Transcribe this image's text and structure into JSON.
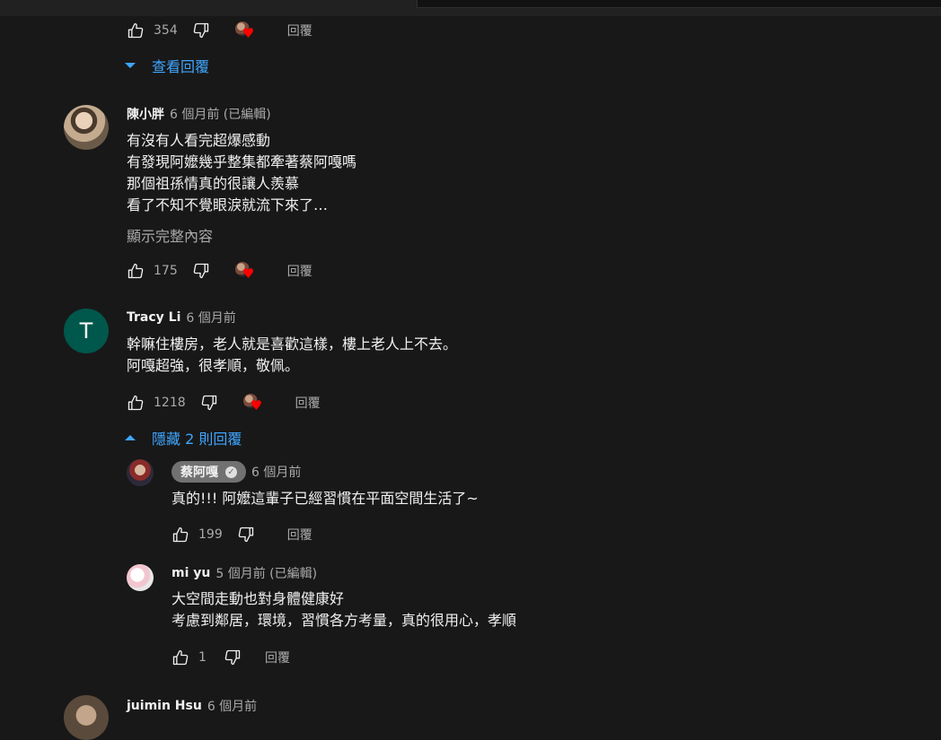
{
  "ui": {
    "reply_label": "回覆"
  },
  "comments": [
    {
      "likes": "354",
      "toggle": "查看回覆"
    },
    {
      "author": "陳小胖",
      "time": "6 個月前 (已編輯)",
      "lines": [
        "有沒有人看完超爆感動",
        "有發現阿嬤幾乎整集都牽著蔡阿嘎嗎",
        "那個祖孫情真的很讓人羨慕",
        "看了不知不覺眼淚就流下來了…"
      ],
      "show_more": "顯示完整內容",
      "likes": "175"
    },
    {
      "author": "Tracy Li",
      "time": "6 個月前",
      "avatar_letter": "T",
      "lines": [
        "幹嘛住樓房，老人就是喜歡這樣，樓上老人上不去。",
        "阿嘎超強，很孝順，敬佩。"
      ],
      "likes": "1218",
      "toggle": "隱藏 2 則回覆"
    },
    {
      "author": "juimin Hsu",
      "time": "6 個月前"
    }
  ],
  "replies": [
    {
      "author": "蔡阿嘎",
      "verified": true,
      "time": "6 個月前",
      "text": "真的!!! 阿嬤這輩子已經習慣在平面空間生活了~",
      "likes": "199"
    },
    {
      "author": "mi yu",
      "time": "5 個月前 (已編輯)",
      "lines": [
        "大空間走動也對身體健康好",
        "考慮到鄰居，環境，習慣各方考量，真的很用心，孝順"
      ],
      "likes": "1"
    }
  ]
}
